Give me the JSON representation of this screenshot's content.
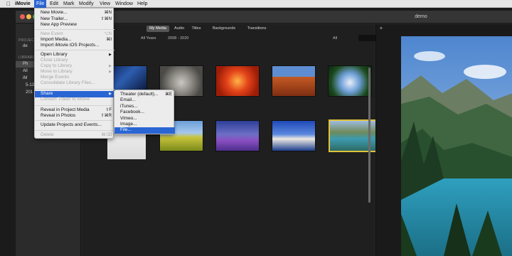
{
  "menubar": {
    "apple": "",
    "items": [
      "iMovie",
      "File",
      "Edit",
      "Mark",
      "Modify",
      "View",
      "Window",
      "Help"
    ]
  },
  "window": {
    "title": "demo"
  },
  "sidebar": {
    "projects_header": "PROJECT",
    "project_item": "de",
    "libraries_header": "LIBRARI",
    "library_items": [
      "Ph",
      "All",
      "iM",
      "5-13",
      "201"
    ]
  },
  "browser": {
    "tabs": [
      "My Media",
      "Audio",
      "Titles",
      "Backgrounds",
      "Transitions"
    ],
    "filter_years": "All Years",
    "filter_range": "2008 - 2020",
    "filter_all": "All"
  },
  "file_menu": {
    "items": [
      {
        "label": "New Movie...",
        "key": "⌘N",
        "disabled": false
      },
      {
        "label": "New Trailer...",
        "key": "⇧⌘N",
        "disabled": false
      },
      {
        "label": "New App Preview",
        "key": "",
        "disabled": false
      },
      {
        "label": "New Event",
        "key": "⌥N",
        "disabled": true
      },
      {
        "label": "Import Media...",
        "key": "⌘I",
        "disabled": false
      },
      {
        "label": "Import iMovie iOS Projects...",
        "key": "",
        "disabled": false
      },
      {
        "label": "Open Library",
        "key": "▶",
        "disabled": false
      },
      {
        "label": "Close Library",
        "key": "",
        "disabled": true
      },
      {
        "label": "Copy to Library",
        "key": "▶",
        "disabled": true
      },
      {
        "label": "Move to Library",
        "key": "▶",
        "disabled": true
      },
      {
        "label": "Merge Events",
        "key": "",
        "disabled": true
      },
      {
        "label": "Consolidate Library Files...",
        "key": "",
        "disabled": true
      },
      {
        "label": "Share",
        "key": "▶",
        "disabled": false
      },
      {
        "label": "Convert Trailer to Movie",
        "key": "",
        "disabled": true
      },
      {
        "label": "Reveal in Project Media",
        "key": "⇧F",
        "disabled": false
      },
      {
        "label": "Reveal in Photos",
        "key": "⇧⌘R",
        "disabled": false
      },
      {
        "label": "Update Projects and Events...",
        "key": "",
        "disabled": false
      },
      {
        "label": "Delete",
        "key": "⌘⌫",
        "disabled": true
      }
    ]
  },
  "share_menu": {
    "items": [
      {
        "label": "Theater (default)...",
        "key": "⌘E"
      },
      {
        "label": "Email...",
        "key": ""
      },
      {
        "label": "iTunes...",
        "key": ""
      },
      {
        "label": "Facebook...",
        "key": ""
      },
      {
        "label": "Vimeo...",
        "key": ""
      },
      {
        "label": "Image...",
        "key": ""
      },
      {
        "label": "File...",
        "key": ""
      }
    ]
  }
}
